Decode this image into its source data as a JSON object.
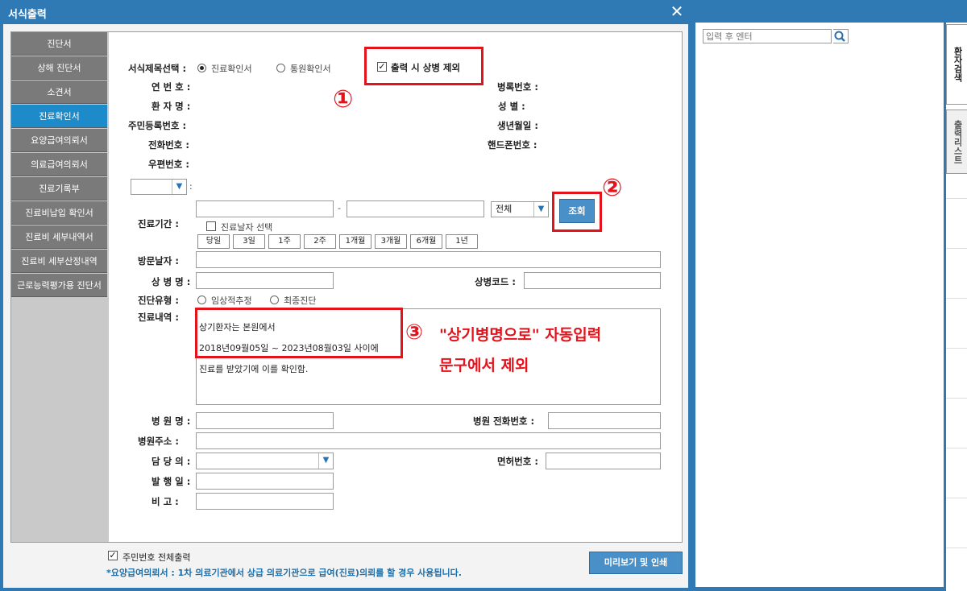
{
  "dialog": {
    "title": "서식출력",
    "close_icon": "✕"
  },
  "menu": [
    {
      "label": "진단서",
      "active": false
    },
    {
      "label": "상해 진단서",
      "active": false
    },
    {
      "label": "소견서",
      "active": false
    },
    {
      "label": "진료확인서",
      "active": true
    },
    {
      "label": "요양급여의뢰서",
      "active": false
    },
    {
      "label": "의료급여의뢰서",
      "active": false
    },
    {
      "label": "진료기록부",
      "active": false
    },
    {
      "label": "진료비납입 확인서",
      "active": false
    },
    {
      "label": "진료비 세부내역서",
      "active": false
    },
    {
      "label": "진료비 세부산정내역",
      "active": false
    },
    {
      "label": "근로능력평가용 진단서",
      "active": false
    }
  ],
  "form": {
    "title_select_label": "서식제목선택 :",
    "radio1_label": "진료확인서",
    "radio2_label": "통원확인서",
    "exclude_disease_label": "출력 시 상병 제외",
    "serial_label": "연 번 호 :",
    "chart_no_label": "병록번호 :",
    "patient_label": "환 자 명 :",
    "gender_label": "성     별 :",
    "rrn_label": "주민등록번호 :",
    "birth_label": "생년월일 :",
    "phone_label": "전화번호 :",
    "mobile_label": "핸드폰번호 :",
    "zip_label": "우편번호 :",
    "small_select_colon": ":",
    "period_label": "진료기간 :",
    "dash": "-",
    "period_select": "전체",
    "search_button": "조회",
    "date_select_label": "진료날자 선택",
    "quick_buttons": [
      "당일",
      "3일",
      "1주",
      "2주",
      "1개월",
      "3개월",
      "6개월",
      "1년"
    ],
    "visit_dates_label": "방문날자 :",
    "disease_name_label": "상 병 명 :",
    "disease_code_label": "상병코드 :",
    "diag_type_label": "진단유형 :",
    "diag_type_opt1": "임상적추정",
    "diag_type_opt2": "최종진단",
    "details_label": "진료내역 :",
    "details_line1": "상기환자는 본원에서",
    "details_line2": "2018년09월05일 ~ 2023년08월03일 사이에",
    "details_line3": "진료를 받았기에 이를 확인함.",
    "hospital_name_label": "병 원 명 :",
    "hospital_phone_label": "병원 전화번호 :",
    "hospital_addr_label": "병원주소 :",
    "doctor_label": "담 당 의 :",
    "license_label": "면허번호 :",
    "issue_date_label": "발 행 일 :",
    "remarks_label": "비     고 :"
  },
  "annotations": {
    "circle1": "①",
    "circle2": "②",
    "circle3": "③",
    "note_line1": "\"상기병명으로\" 자동입력",
    "note_line2": "문구에서 제외",
    "color": "#e3121b"
  },
  "footer": {
    "print_rrn_label": "주민번호 전체출력",
    "notice": "*요양급여의뢰서 : 1차 의료기관에서 상급 의료기관으로 급여(진료)의뢰를 할 경우 사용됩니다.",
    "preview_button": "미리보기 및 인쇄"
  },
  "search_panel": {
    "placeholder": "입력 후 엔터",
    "search_icon": "search-icon",
    "tab_patient": "환자검색",
    "tab_print_list": "출력리스트"
  },
  "colors": {
    "titlebar": "#2f79b5",
    "menu_bg": "#7a7a7a",
    "menu_active": "#1d8ac9",
    "button_blue": "#4a90c8"
  }
}
